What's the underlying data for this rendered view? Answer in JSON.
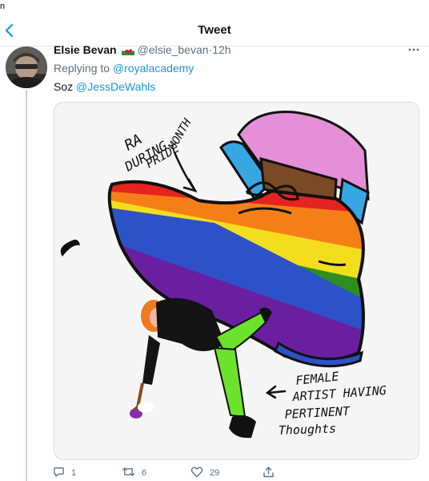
{
  "status_bar": {
    "corner_text": "n"
  },
  "header": {
    "title": "Tweet",
    "back_icon": "chevron-left-icon"
  },
  "tweet": {
    "display_name": "Elsie Bevan",
    "flag_icon": "wales-flag-icon",
    "handle": "@elsie_bevan",
    "separator": "·",
    "time": "12h",
    "more_icon": "more-horizontal-icon",
    "replying_prefix": "Replying to",
    "replying_to": "@royalacademy",
    "text_prefix": "Soz",
    "mention": "@JessDeWahls",
    "image": {
      "caption_top_1": "RA",
      "caption_top_2": "DURING",
      "caption_top_3": "PRIDE",
      "caption_top_4": "MONTH",
      "caption_bottom_1": "FEMALE",
      "caption_bottom_2": "ARTIST HAVING",
      "caption_bottom_3": "PERTINENT",
      "caption_bottom_4": "Thoughts",
      "rainbow_colors": [
        "#e52420",
        "#f57f17",
        "#f2de1d",
        "#2e8f1d",
        "#2d52c8",
        "#6a1fa1"
      ]
    },
    "actions": {
      "reply_count": "1",
      "retweet_count": "6",
      "like_count": "29",
      "reply_icon": "reply-icon",
      "retweet_icon": "retweet-icon",
      "like_icon": "heart-icon",
      "share_icon": "share-icon"
    }
  },
  "colors": {
    "link": "#1b95e0",
    "secondary_text": "#5b7083",
    "divider": "#e1e8ed"
  }
}
